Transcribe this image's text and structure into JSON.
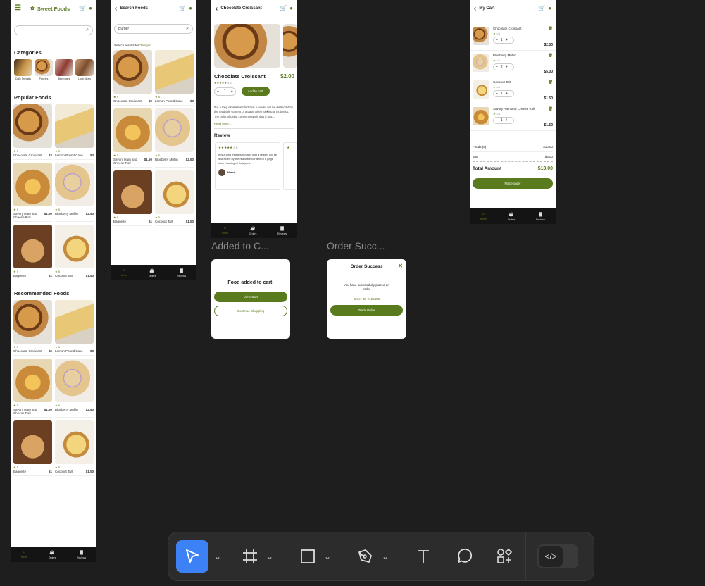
{
  "home": {
    "brand": "Sweet Foods",
    "search_placeholder": "",
    "categories_title": "Categories",
    "categories": [
      {
        "label": "Daily Specials"
      },
      {
        "label": "Pastries"
      },
      {
        "label": "Beverages"
      },
      {
        "label": "Light Meals"
      }
    ],
    "popular_title": "Popular Foods",
    "recommended_title": "Recommended Foods",
    "foods": [
      {
        "name": "Chocolate Croissant",
        "price": "$2",
        "rating": "5"
      },
      {
        "name": "Lemon Pound Cake",
        "price": "$3",
        "rating": "5"
      },
      {
        "name": "Savory Ham and Cheese Roll",
        "price": "$1.50",
        "rating": "5"
      },
      {
        "name": "Blueberry Muffin",
        "price": "$2.50",
        "rating": "5"
      },
      {
        "name": "Baguette",
        "price": "$1",
        "rating": "5"
      },
      {
        "name": "Coconut Tart",
        "price": "$1.50",
        "rating": "5"
      }
    ]
  },
  "nav": {
    "home": "Home",
    "orders": "Orders",
    "reviews": "Reviews"
  },
  "search": {
    "title": "Search Foods",
    "query": "Burger",
    "results_prefix": "Search results for ",
    "results_query": "\"Burger\"",
    "items": [
      {
        "name": "Chocolate Croissant",
        "price": "$2",
        "rating": "5"
      },
      {
        "name": "Lemon Pound Cake",
        "price": "$3",
        "rating": "5"
      },
      {
        "name": "Savory Ham and Cheese Roll",
        "price": "$1.50",
        "rating": "5"
      },
      {
        "name": "Blueberry Muffin",
        "price": "$2.50",
        "rating": "5"
      },
      {
        "name": "Baguette",
        "price": "$1",
        "rating": "5"
      },
      {
        "name": "Coconut Tart",
        "price": "$1.50",
        "rating": "5"
      }
    ]
  },
  "detail": {
    "title": "Chocolate Croissant",
    "name": "Chocolate Croissant",
    "price": "$2.00",
    "rating": "4.6",
    "qty": "1",
    "add_to_cart": "Add to cart",
    "description": "It is a long established fact that a reader will be distracted by the readable content of a page when looking at its layout. The point of using Lorem Ipsum is that it has...",
    "read_more": "Read More...",
    "review_title": "Review",
    "review_rating": "4.6",
    "review_text": "It is a long established fact that a reader will be distracted by the readable content of a page when looking at its layout.",
    "reviewer": "Name"
  },
  "cart": {
    "title": "My Cart",
    "items": [
      {
        "name": "Chocolate Croissant",
        "rating": "4.6",
        "qty": "1",
        "price": "$2.00"
      },
      {
        "name": "Blueberry Muffin",
        "rating": "4.6",
        "qty": "2",
        "price": "$5.00"
      },
      {
        "name": "Coconut Tart",
        "rating": "4.6",
        "qty": "1",
        "price": "$1.50"
      },
      {
        "name": "Savory Ham and Cheese Roll",
        "rating": "4.6",
        "qty": "1",
        "price": "$1.50"
      }
    ],
    "foods_label": "Foods (5)",
    "foods_value": "$10.00",
    "tax_label": "Tax",
    "tax_value": "$3.00",
    "total_label": "Total Amount",
    "total_value": "$13.00",
    "place_order": "Place order"
  },
  "added_modal": {
    "frame_label": "Added to C...",
    "title": "Food added to cart!",
    "view_cart": "View Cart",
    "continue": "Continue Shopping"
  },
  "success_modal": {
    "frame_label": "Order Succ...",
    "title": "Order Success",
    "message": "You have successfully placed an order",
    "order_id": "Order ID: #125456",
    "track": "Track Order"
  },
  "toolbar": {
    "tools": [
      "move-tool",
      "frame-tool",
      "shape-tool",
      "pen-tool",
      "text-tool",
      "comment-tool",
      "actions-tool",
      "dev-mode-toggle"
    ]
  },
  "colors": {
    "accent": "#5a7a1e",
    "canvas": "#1e1e1e",
    "toolbar": "#2c2c2c",
    "active_tool": "#3c82f6",
    "nav": "#141414"
  }
}
